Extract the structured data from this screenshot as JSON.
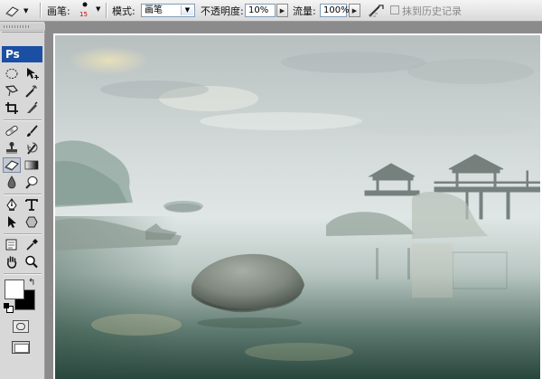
{
  "options_bar": {
    "brush_label": "画笔:",
    "brush_size": "15",
    "mode_label": "模式:",
    "mode_value": "画笔",
    "opacity_label": "不透明度:",
    "opacity_value": "10%",
    "flow_label": "流量:",
    "flow_value": "100%",
    "erase_history_label": "抹到历史记录",
    "erase_history_checked": false
  },
  "toolbox": {
    "logo": "Ps",
    "active_tool": "eraser-tool"
  },
  "colors": {
    "foreground": "#ffffff",
    "background": "#000000",
    "accent": "#1b4fa3"
  },
  "document": {
    "description_icons": [
      "fog-lake-photo"
    ]
  }
}
